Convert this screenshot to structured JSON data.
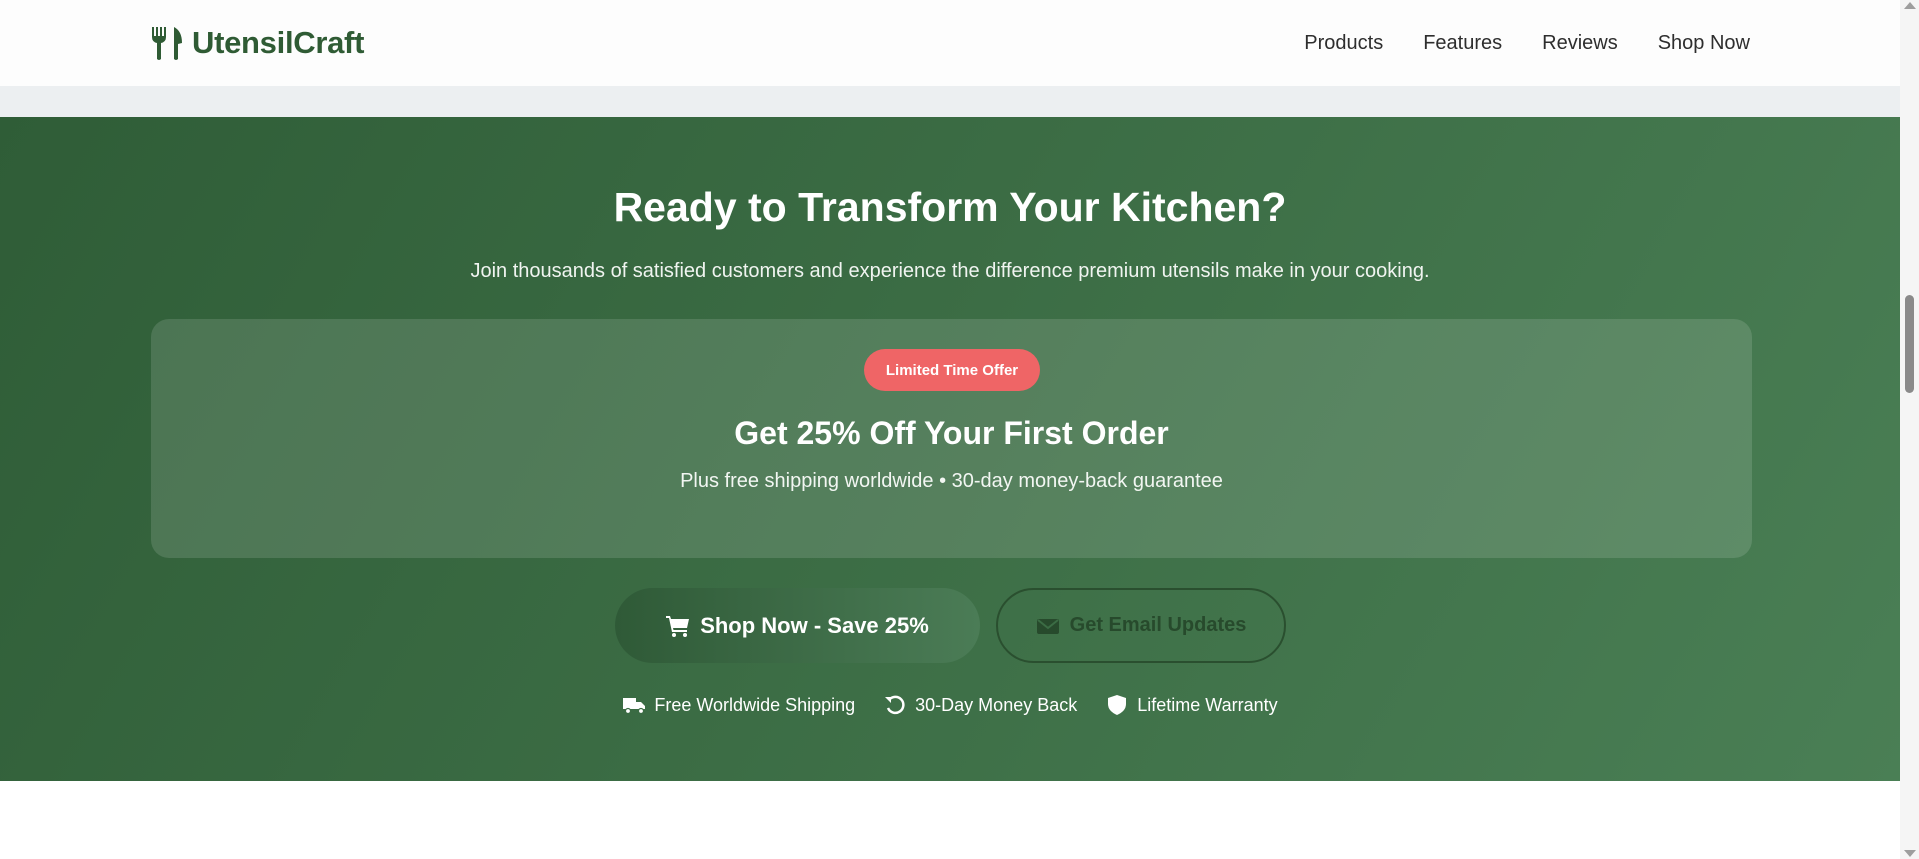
{
  "header": {
    "brand": "UtensilCraft",
    "nav": [
      {
        "label": "Products"
      },
      {
        "label": "Features"
      },
      {
        "label": "Reviews"
      },
      {
        "label": "Shop Now"
      }
    ]
  },
  "cta": {
    "title": "Ready to Transform Your Kitchen?",
    "subtitle": "Join thousands of satisfied customers and experience the difference premium utensils make in your cooking.",
    "offer": {
      "badge": "Limited Time Offer",
      "title": "Get 25% Off Your First Order",
      "subtitle": "Plus free shipping worldwide • 30-day money-back guarantee"
    },
    "primary_button": {
      "label": "Shop Now - Save 25%",
      "icon": "shopping-cart-icon"
    },
    "secondary_button": {
      "label": "Get Email Updates",
      "icon": "envelope-icon"
    },
    "guarantees": [
      {
        "label": "Free Worldwide Shipping",
        "icon": "shipping-truck-icon"
      },
      {
        "label": "30-Day Money Back",
        "icon": "undo-icon"
      },
      {
        "label": "Lifetime Warranty",
        "icon": "shield-icon"
      }
    ]
  },
  "colors": {
    "brand_green": "#2f5b34",
    "section_green": "#3b6c44",
    "badge_red": "#ef6566"
  }
}
